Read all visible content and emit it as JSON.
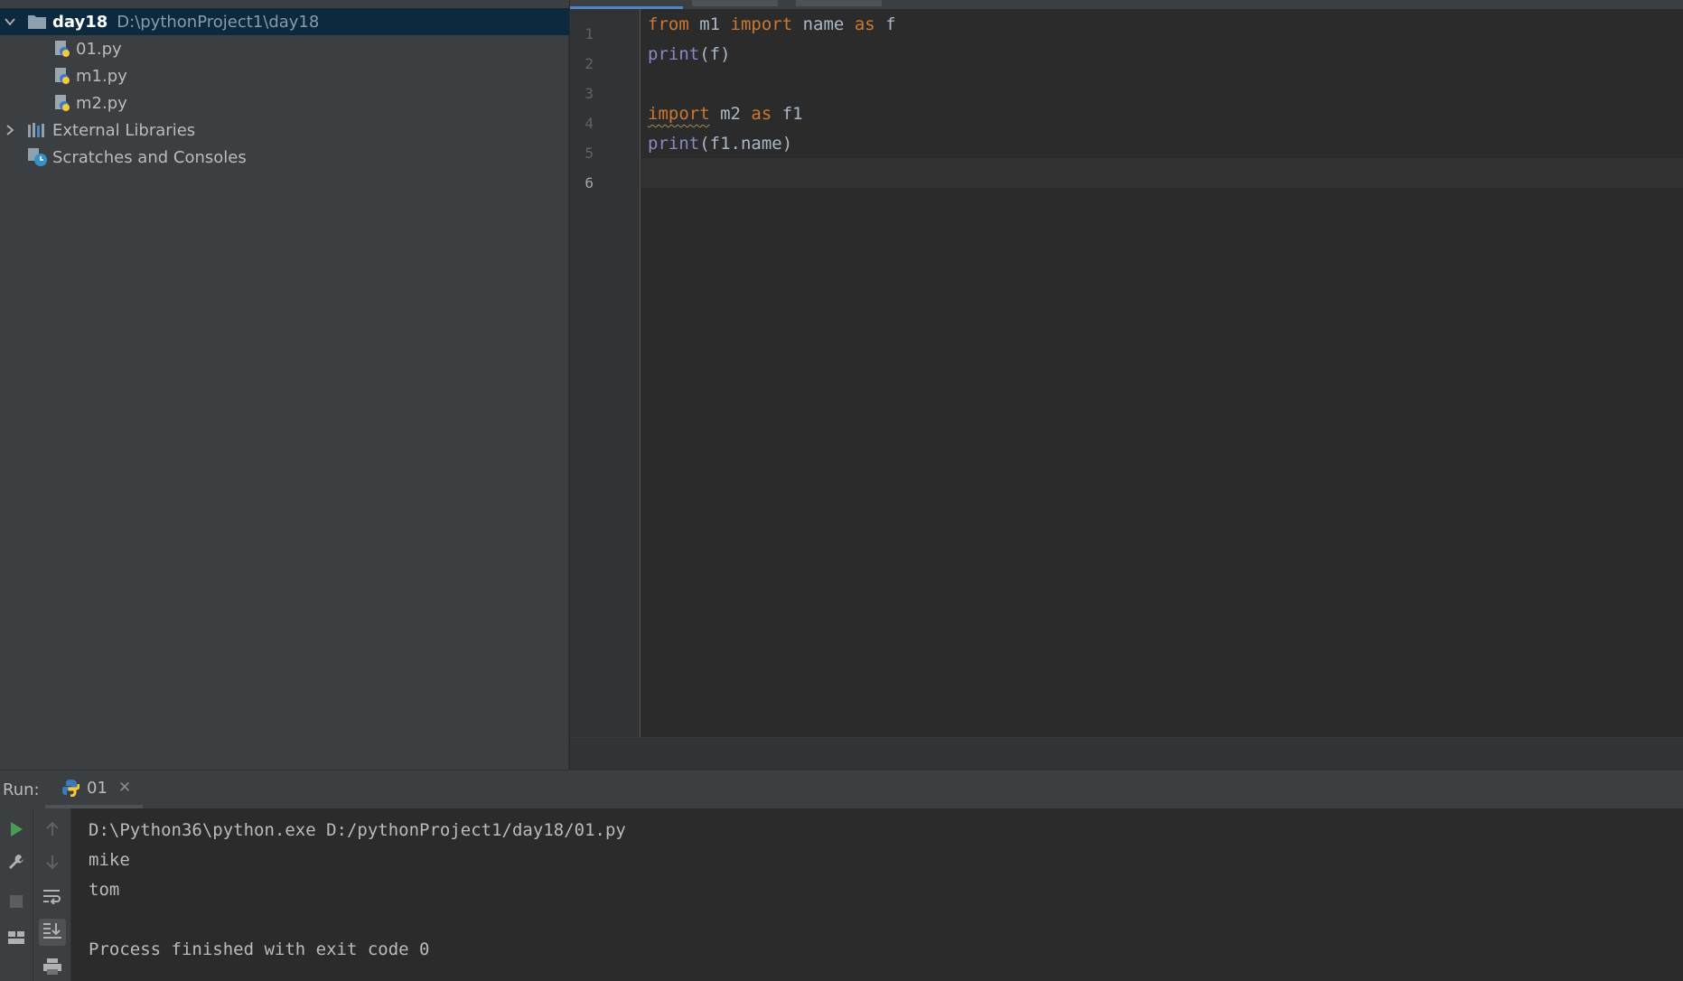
{
  "project_tree": {
    "root": {
      "name": "day18",
      "path": "D:\\pythonProject1\\day18",
      "expanded": true
    },
    "files": [
      {
        "name": "01.py",
        "icon": "python-file-icon"
      },
      {
        "name": "m1.py",
        "icon": "python-file-icon"
      },
      {
        "name": "m2.py",
        "icon": "python-file-icon"
      }
    ],
    "external_libraries": "External Libraries",
    "scratches": "Scratches and Consoles"
  },
  "editor": {
    "line_numbers": [
      "1",
      "2",
      "3",
      "4",
      "5",
      "6"
    ],
    "current_line": 6,
    "code": [
      [
        {
          "t": "from",
          "c": "kw"
        },
        {
          "t": " m1 "
        },
        {
          "t": "import",
          "c": "kw"
        },
        {
          "t": " name "
        },
        {
          "t": "as",
          "c": "kw"
        },
        {
          "t": " f"
        }
      ],
      [
        {
          "t": "print",
          "c": "fn"
        },
        {
          "t": "(f)"
        }
      ],
      [],
      [
        {
          "t": "import",
          "c": "kw warn"
        },
        {
          "t": " m2 "
        },
        {
          "t": "as",
          "c": "kw"
        },
        {
          "t": " f1"
        }
      ],
      [
        {
          "t": "print",
          "c": "fn"
        },
        {
          "t": "(f1.name)"
        }
      ],
      []
    ]
  },
  "run": {
    "label": "Run:",
    "tab_label": "01",
    "output": [
      "D:\\Python36\\python.exe D:/pythonProject1/day18/01.py",
      "mike",
      "tom",
      "",
      "Process finished with exit code 0"
    ]
  },
  "colors": {
    "keyword": "#cc7832",
    "builtin": "#8888c6",
    "text": "#a9b7c6",
    "selection": "#0d293e",
    "run_green": "#499c54"
  }
}
